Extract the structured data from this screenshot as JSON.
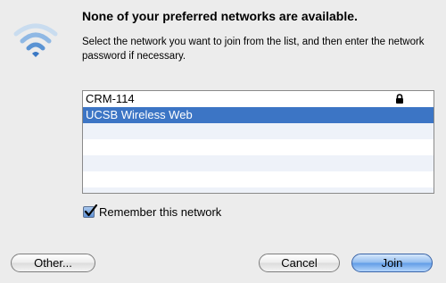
{
  "dialog": {
    "title": "None of your preferred networks are available.",
    "message": "Select the network you want to join from the list, and then enter the network password if necessary."
  },
  "networks": [
    {
      "name": "CRM-114",
      "secured": true,
      "selected": false
    },
    {
      "name": "UCSB Wireless Web",
      "secured": false,
      "selected": true
    }
  ],
  "remember": {
    "label": "Remember this network",
    "checked": true
  },
  "buttons": {
    "other": "Other...",
    "cancel": "Cancel",
    "join": "Join"
  },
  "colors": {
    "selection": "#3c75c5",
    "default_button": "#5f9be6"
  },
  "icons": {
    "app": "wifi-icon",
    "secured": "lock-icon",
    "checkbox": "checkmark-icon"
  }
}
